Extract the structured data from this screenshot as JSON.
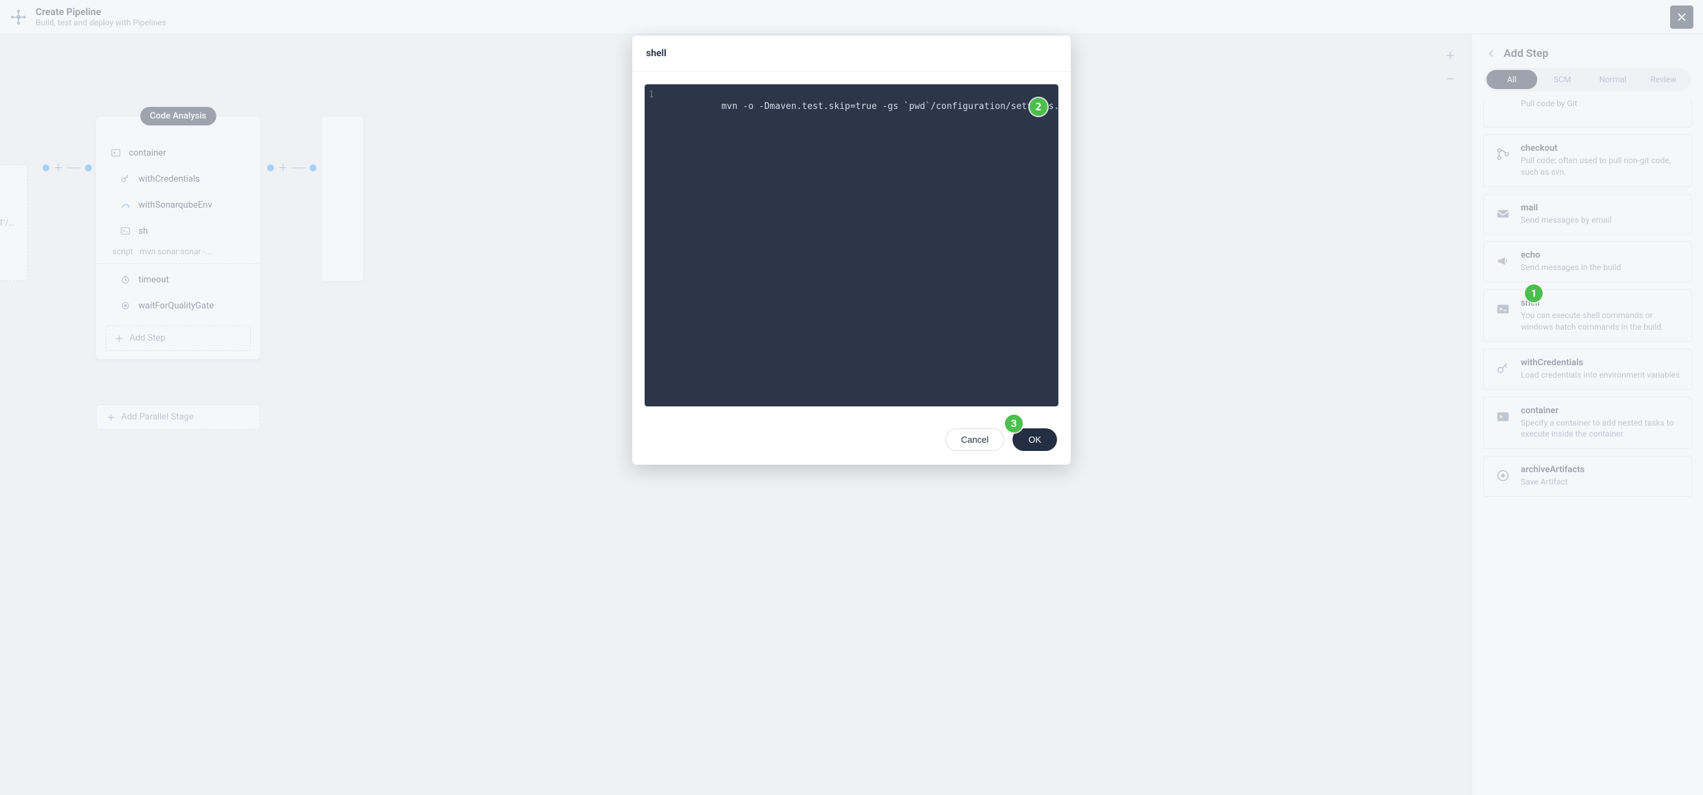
{
  "header": {
    "title": "Create Pipeline",
    "subtitle": "Build, test and deploy with Pipelines"
  },
  "canvas": {
    "stage_title": "Code Analysis",
    "steps": {
      "container": "container",
      "withCredentials": "withCredentials",
      "withSonarqubeEnv": "withSonarqubeEnv",
      "sh": "sh",
      "timeout": "timeout",
      "waitForQualityGate": "waitForQualityGate"
    },
    "script_key": "script",
    "script_val": "mvn sonar:sonar -...",
    "add_step": "Add Step",
    "add_parallel": "Add Parallel Stage",
    "prev_frag": "T'/..."
  },
  "sidebar": {
    "title": "Add Step",
    "tabs": {
      "all": "All",
      "scm": "SCM",
      "normal": "Normal",
      "review": "Review"
    },
    "items": [
      {
        "title": "",
        "desc": "Pull code by Git"
      },
      {
        "title": "checkout",
        "desc": "Pull code; often used to pull non-git code, such as svn."
      },
      {
        "title": "mail",
        "desc": "Send messages by email"
      },
      {
        "title": "echo",
        "desc": "Send messages in the build"
      },
      {
        "title": "shell",
        "desc": "You can execute shell commands or windows batch commands in the build."
      },
      {
        "title": "withCredentials",
        "desc": "Load credentials into environment variables"
      },
      {
        "title": "container",
        "desc": "Specify a container to add nested tasks to execute inside the container"
      },
      {
        "title": "archiveArtifacts",
        "desc": "Save Artifact"
      }
    ]
  },
  "modal": {
    "title": "shell",
    "line_number": "1",
    "code": "mvn -o -Dmaven.test.skip=true -gs `pwd`/configuration/settings.xml clean package",
    "cancel": "Cancel",
    "ok": "OK"
  },
  "callouts": {
    "c1": "1",
    "c2": "2",
    "c3": "3"
  }
}
